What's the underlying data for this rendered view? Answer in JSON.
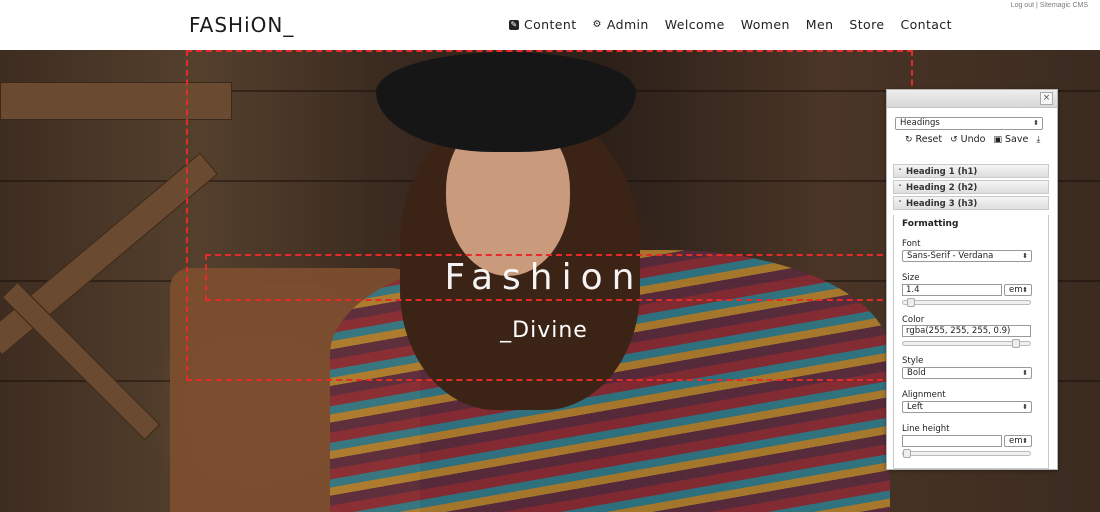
{
  "header": {
    "logo": "FASHiON_",
    "nav": [
      {
        "label": "Content",
        "icon": "edit-icon"
      },
      {
        "label": "Admin",
        "icon": "gear-icon"
      },
      {
        "label": "Welcome"
      },
      {
        "label": "Women"
      },
      {
        "label": "Men"
      },
      {
        "label": "Store"
      },
      {
        "label": "Contact"
      }
    ],
    "toplinks": {
      "logout": "Log out",
      "separator": "|",
      "cms": "Sitemagic CMS"
    }
  },
  "hero": {
    "title": "Fashion",
    "subtitle": "_Divine",
    "accent_color": "#e52a2a"
  },
  "designer": {
    "category_select": "Headings",
    "toolbar": {
      "reset": "Reset",
      "undo": "Undo",
      "save": "Save"
    },
    "sections": [
      "Heading 1 (h1)",
      "Heading 2 (h2)",
      "Heading 3 (h3)"
    ],
    "formatting_label": "Formatting",
    "font": {
      "label": "Font",
      "value": "Sans-Serif - Verdana"
    },
    "size": {
      "label": "Size",
      "value": "1.4",
      "unit": "em",
      "slider_fraction": 0.03
    },
    "color": {
      "label": "Color",
      "value": "rgba(255, 255, 255, 0.9)",
      "slider_fraction": 0.9
    },
    "style": {
      "label": "Style",
      "value": "Bold"
    },
    "alignment": {
      "label": "Alignment",
      "value": "Left"
    },
    "line_height": {
      "label": "Line height",
      "value": "",
      "unit": "em",
      "slider_fraction": 0.0
    }
  }
}
